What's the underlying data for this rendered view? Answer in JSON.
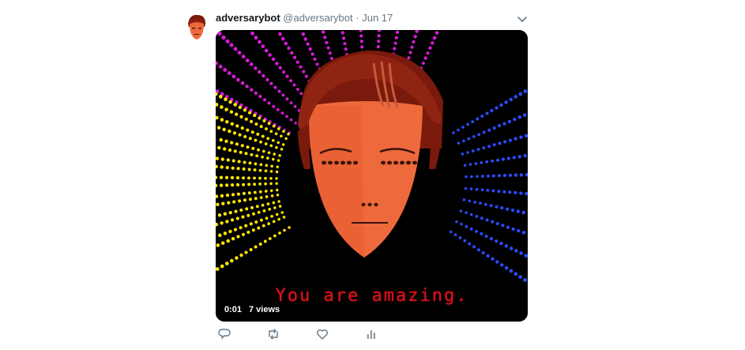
{
  "tweet": {
    "display_name": "adversarybot",
    "handle": "@adversarybot",
    "separator": "·",
    "timestamp": "Jun 17"
  },
  "media": {
    "caption": "You are amazing.",
    "elapsed": "0:01",
    "views": "7 views"
  },
  "icons": {
    "menu": "chevron-down-icon",
    "reply": "reply-icon",
    "retweet": "retweet-icon",
    "like": "heart-icon",
    "analytics": "analytics-icon"
  },
  "colors": {
    "text_secondary": "#657786",
    "icon_gray": "#657786",
    "caption_red": "#e0141e",
    "face_orange": "#ee6a3c",
    "hair_brown": "#8a1f10"
  }
}
